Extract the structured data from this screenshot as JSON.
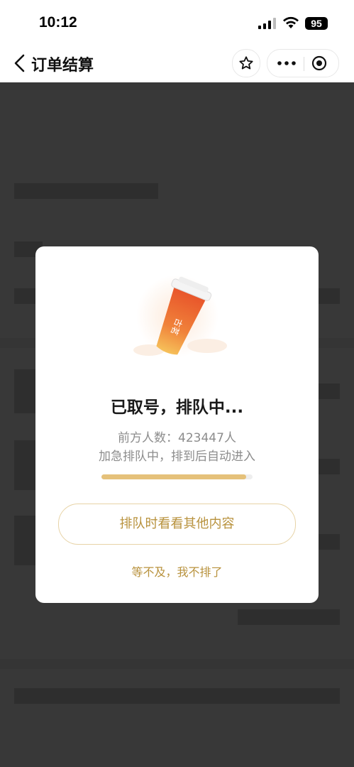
{
  "status_bar": {
    "time": "10:12",
    "battery": "95"
  },
  "nav": {
    "title": "订单结算"
  },
  "modal": {
    "title": "已取号，排队中...",
    "queue_text": "前方人数：423447人",
    "hint_text": "加急排队中，排到后自动进入",
    "progress": 0.96,
    "browse_button": "排队时看看其他内容",
    "give_up_link": "等不及，我不排了",
    "cup_text": "古茗"
  },
  "colors": {
    "accent": "#b8923d",
    "progress": "#e5c17a",
    "cup_orange": "#e8642c",
    "overlay": "#383838"
  }
}
